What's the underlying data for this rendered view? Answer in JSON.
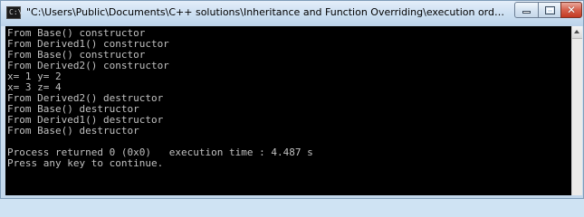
{
  "window": {
    "title": "\"C:\\Users\\Public\\Documents\\C++ solutions\\Inheritance and Function Overriding\\execution order ...",
    "icon": "console-app-icon"
  },
  "controls": {
    "minimize": "minimize-icon",
    "maximize": "maximize-icon",
    "close": "close-icon"
  },
  "console": {
    "lines": [
      "From Base() constructor",
      "From Derived1() constructor",
      "From Base() constructor",
      "From Derived2() constructor",
      "x= 1 y= 2",
      "x= 3 z= 4",
      "From Derived2() destructor",
      "From Base() destructor",
      "From Derived1() destructor",
      "From Base() destructor",
      "",
      "Process returned 0 (0x0)   execution time : 4.487 s",
      "Press any key to continue."
    ],
    "background": "#000000",
    "text_color": "#c0c0c0"
  }
}
